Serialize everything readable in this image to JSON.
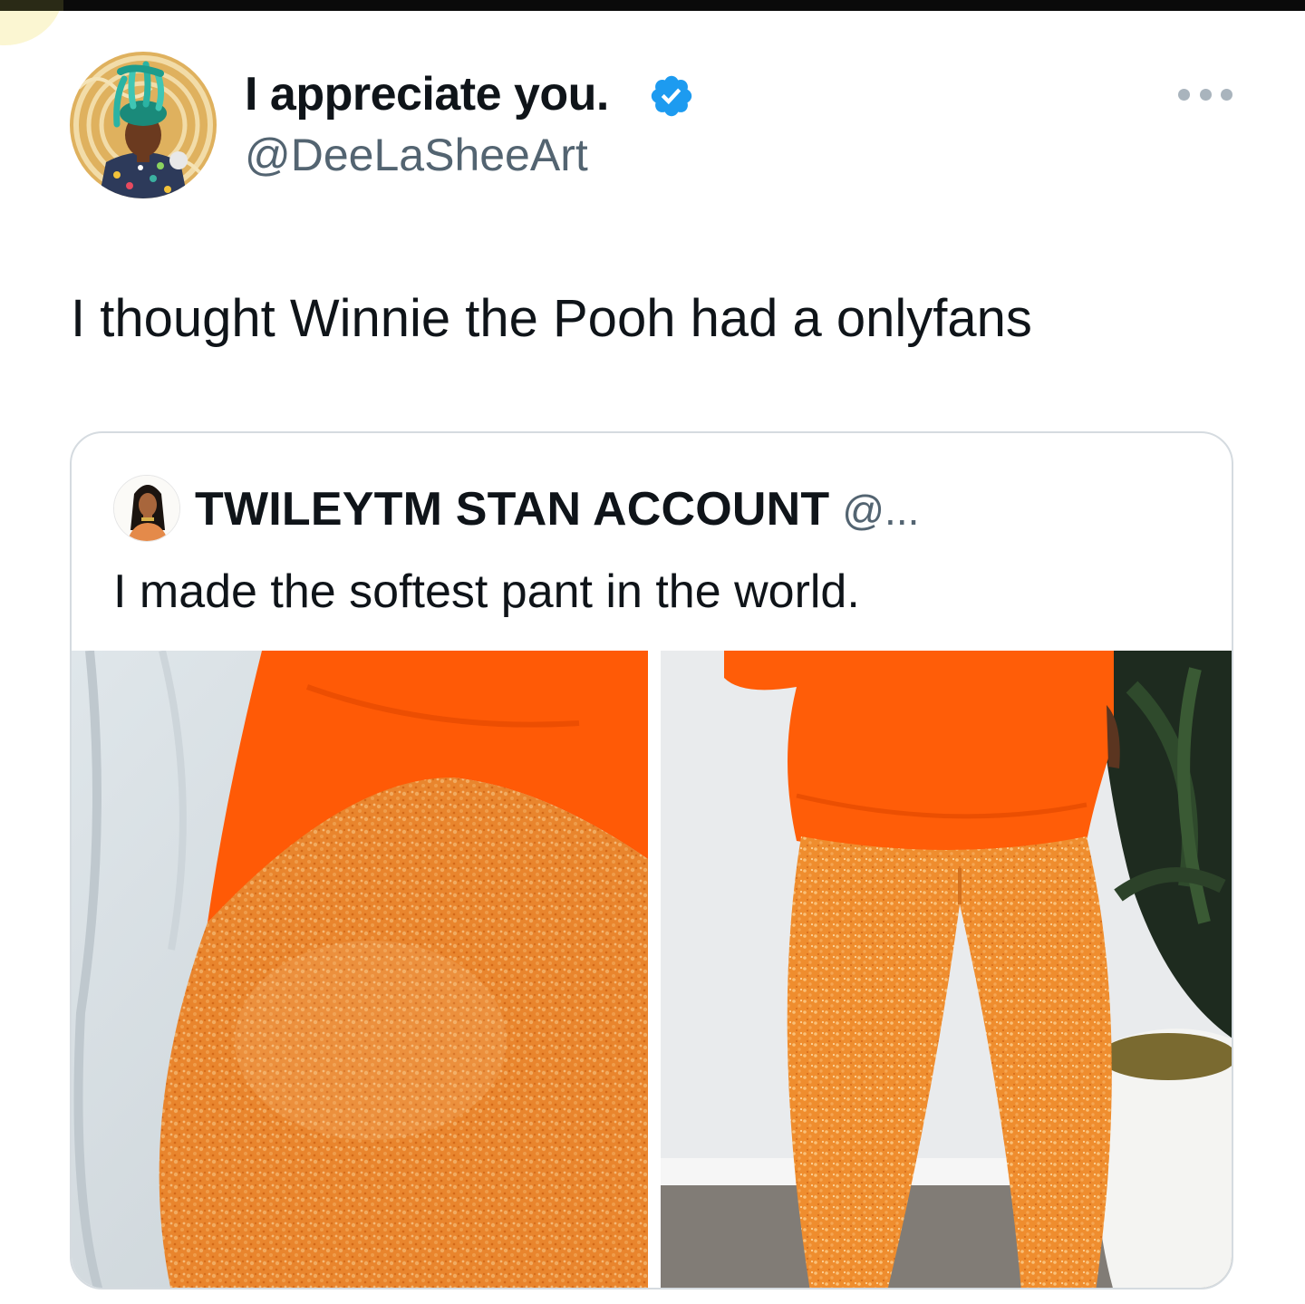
{
  "tweet": {
    "display_name": "I appreciate you.",
    "handle": "@DeeLaSheeArt",
    "text": "I thought Winnie the Pooh had a onlyfans",
    "verified_icon": "verified-badge-icon",
    "more_icon": "more-options-icon"
  },
  "quote": {
    "display_name": "TWILEYTM STAN ACCOUNT",
    "handle": "@...",
    "text": "I made the softest pant in the world."
  },
  "colors": {
    "verified_blue": "#1d9bf0",
    "secondary_text": "#536471",
    "primary_text": "#0f1419",
    "card_border": "#d5dbe0",
    "fuzzy_orange": "#f0892a",
    "sweater_orange": "#ff5a06"
  }
}
